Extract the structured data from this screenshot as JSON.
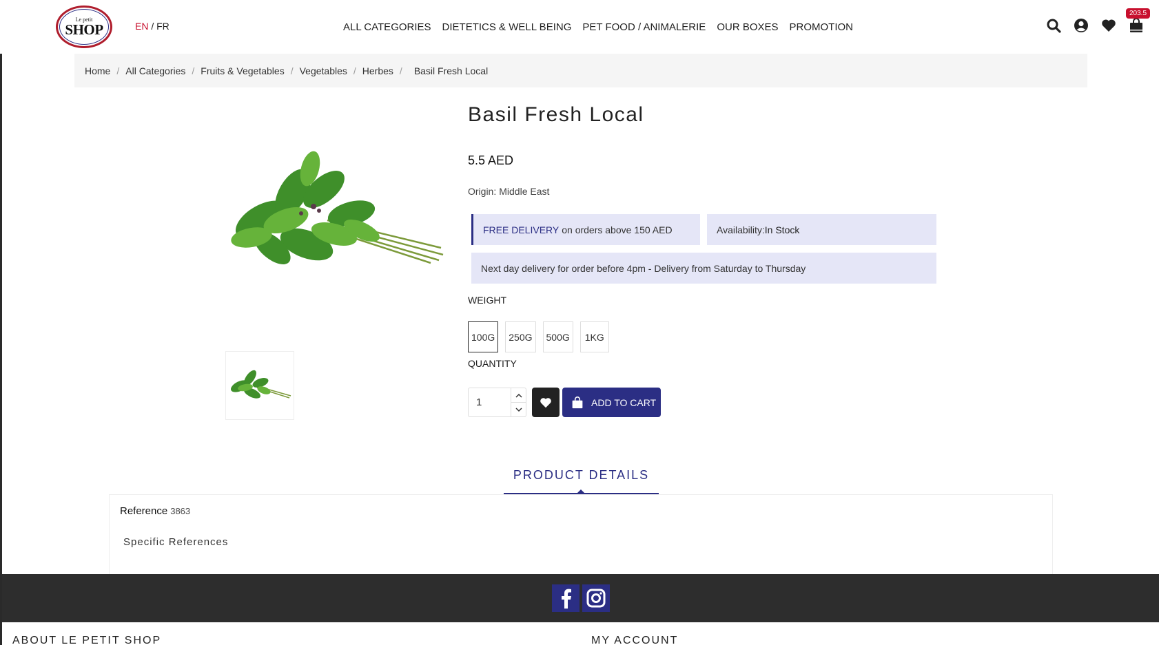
{
  "logo": {
    "small": "Le petit",
    "big": "SHOP"
  },
  "lang": {
    "en": "EN",
    "sep": "/",
    "fr": "FR"
  },
  "nav": [
    "ALL CATEGORIES",
    "DIETETICS & WELL BEING",
    "PET FOOD / ANIMALERIE",
    "OUR BOXES",
    "PROMOTION"
  ],
  "header_icons": [
    "search-icon",
    "account-icon",
    "heart-icon",
    "cart-icon"
  ],
  "cart_total": "203.5",
  "breadcrumb": [
    "Home",
    "All Categories",
    "Fruits & Vegetables",
    "Vegetables",
    "Herbes",
    "Basil Fresh Local"
  ],
  "product": {
    "title": "Basil Fresh Local",
    "price": "5.5 AED",
    "origin_label": "Origin:",
    "origin_value": "Middle East",
    "free_delivery_strong": "FREE DELIVERY",
    "free_delivery_rest": "on orders above 150 AED",
    "availability_label": "Availability:",
    "availability_value": "In Stock",
    "next_day": "Next day delivery for order before 4pm - Delivery from Saturday to Thursday",
    "weight_label": "WEIGHT",
    "weights": [
      "100G",
      "250G",
      "500G",
      "1KG"
    ],
    "selected_weight": "100G",
    "quantity_label": "QUANTITY",
    "quantity": "1",
    "add_to_cart": "ADD TO CART"
  },
  "tabs": {
    "details": "PRODUCT DETAILS"
  },
  "details": {
    "reference_label": "Reference",
    "reference_value": "3863",
    "specific": "Specific References"
  },
  "footer": {
    "about": "ABOUT LE PETIT SHOP",
    "account": "MY ACCOUNT",
    "social": [
      "facebook-icon",
      "instagram-icon"
    ]
  },
  "colors": {
    "brand": "#2b2e84",
    "accent": "#c8102e",
    "info_bg": "#e5e6f7"
  }
}
